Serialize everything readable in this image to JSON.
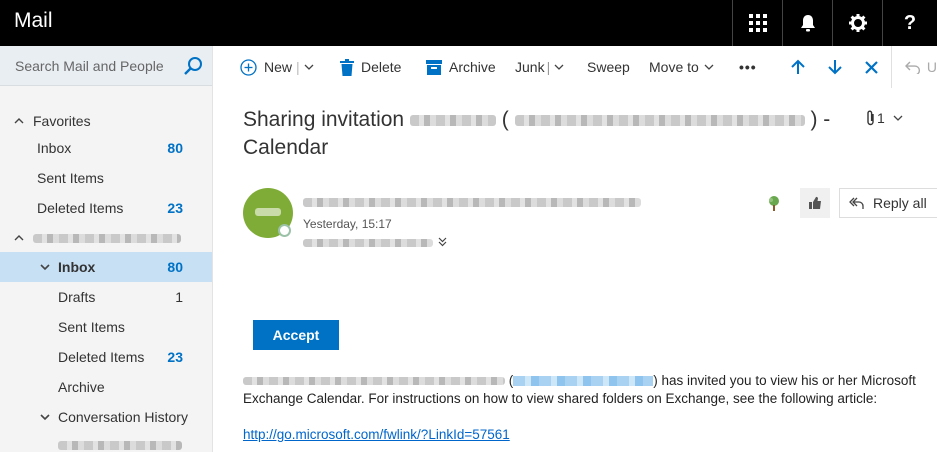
{
  "header": {
    "app_title": "Mail",
    "buttons": [
      "app-launcher-icon",
      "bell-icon",
      "gear-icon",
      "help-icon"
    ]
  },
  "search": {
    "placeholder": "Search Mail and People"
  },
  "toolbar": {
    "new_label": "New",
    "delete_label": "Delete",
    "archive_label": "Archive",
    "junk_label": "Junk",
    "sweep_label": "Sweep",
    "moveto_label": "Move to",
    "more_label": "•••",
    "undo_label": "U"
  },
  "sidebar": {
    "favorites_label": "Favorites",
    "favorites": [
      {
        "label": "Inbox",
        "count": "80"
      },
      {
        "label": "Sent Items",
        "count": ""
      },
      {
        "label": "Deleted Items",
        "count": "23"
      }
    ],
    "folders": [
      {
        "label": "Inbox",
        "count": "80"
      },
      {
        "label": "Drafts",
        "count": "1"
      },
      {
        "label": "Sent Items",
        "count": ""
      },
      {
        "label": "Deleted Items",
        "count": "23"
      },
      {
        "label": "Archive",
        "count": ""
      },
      {
        "label": "Conversation History",
        "count": ""
      }
    ]
  },
  "message": {
    "subject_line1": "Sharing invitation",
    "subject_paren_open": "(",
    "subject_paren_close": ") -",
    "subject_line2": "Calendar",
    "attachment_count": "1",
    "date": "Yesterday, 15:17",
    "reply_all_label": "Reply all",
    "accept_label": "Accept",
    "body_invite_text": ") has invited you to view his or her Microsoft",
    "body_paren_open": "(",
    "body_line2": "Exchange Calendar. For instructions on how to view shared folders on Exchange, see the following article:",
    "link": "http://go.microsoft.com/fwlink/?LinkId=57561"
  },
  "colors": {
    "accent": "#0072c6",
    "selected": "#c7e0f4",
    "avatar": "#7fac36",
    "topbar": "#000000"
  }
}
